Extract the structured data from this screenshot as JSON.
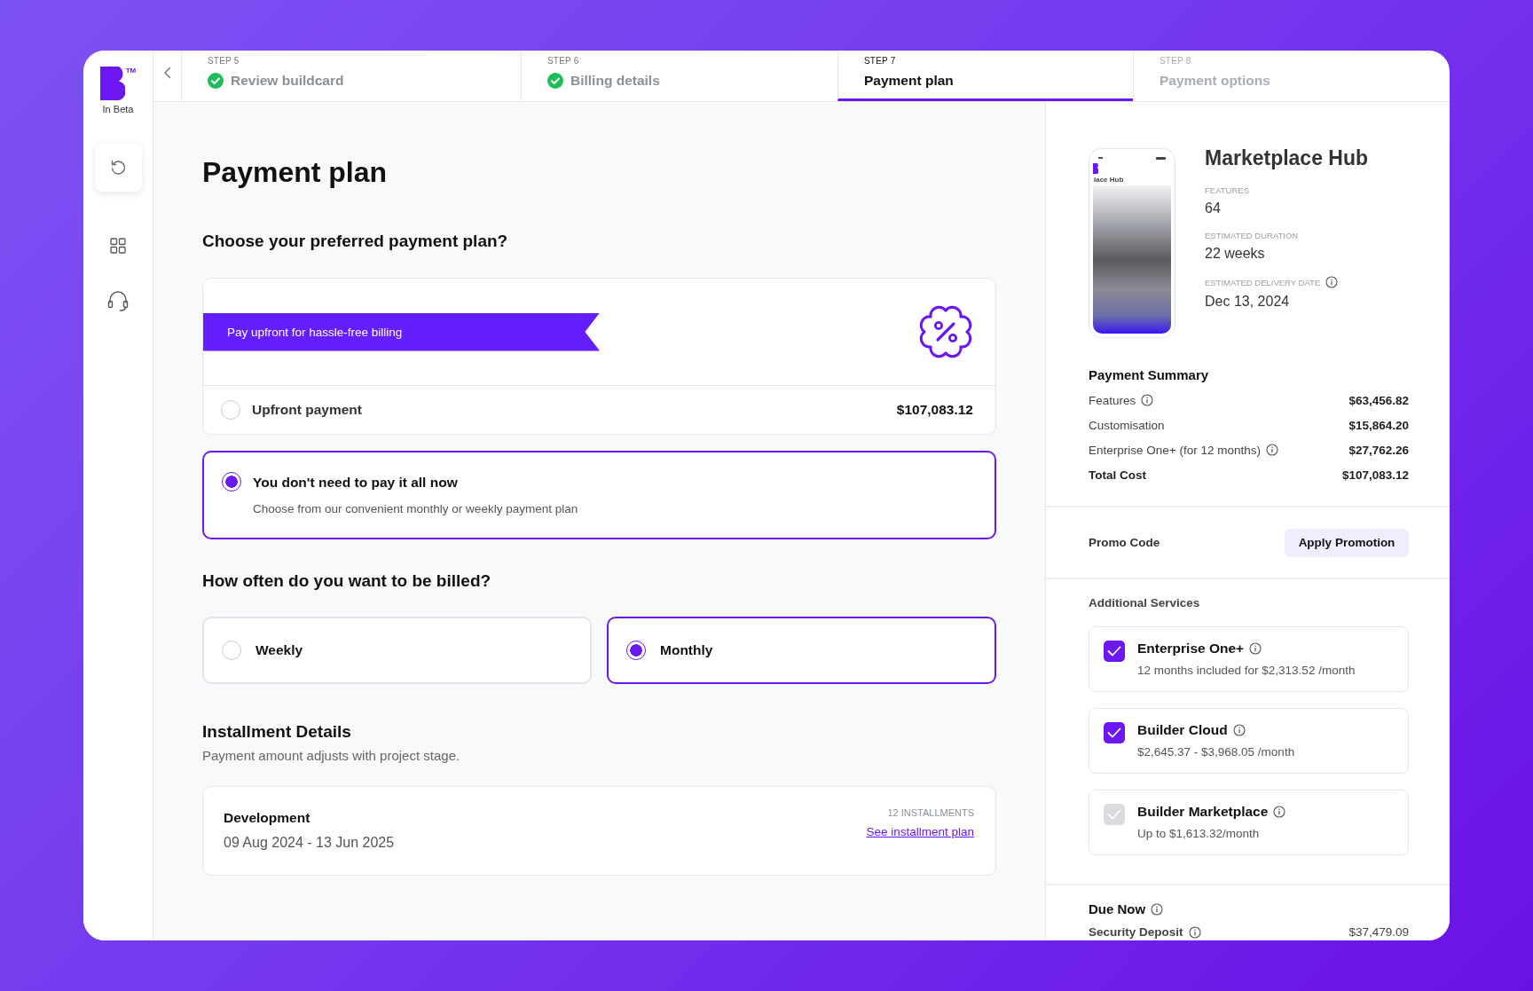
{
  "sidebar": {
    "logo_trademark": "TM",
    "logo_caption": "In Beta"
  },
  "stepper": {
    "steps": [
      {
        "label": "STEP 5",
        "title": "Review buildcard",
        "done": true,
        "selected": false
      },
      {
        "label": "STEP 6",
        "title": "Billing details",
        "done": true,
        "selected": false
      },
      {
        "label": "STEP 7",
        "title": "Payment plan",
        "done": false,
        "selected": true
      },
      {
        "label": "STEP 8",
        "title": "Payment options",
        "done": false,
        "selected": false
      }
    ]
  },
  "main": {
    "title": "Payment plan",
    "plan_question": "Choose your preferred payment plan?",
    "plans": [
      {
        "kind": "upfront",
        "banner": "Pay upfront for hassle-free billing",
        "label": "Upfront payment",
        "amount": "$107,083.12",
        "selected": false
      },
      {
        "kind": "installments",
        "label": "You don't need to pay it all now",
        "description": "Choose from our convenient monthly or weekly payment plan",
        "selected": true
      }
    ],
    "billing_question": "How often do you want to be billed?",
    "billing_options": [
      {
        "label": "Weekly",
        "selected": false
      },
      {
        "label": "Monthly",
        "selected": true
      }
    ],
    "installments": {
      "title": "Installment Details",
      "subtitle": "Payment amount adjusts with project stage.",
      "stages": [
        {
          "name": "Development",
          "dates": "09 Aug 2024 - 13 Jun 2025",
          "count": "12 INSTALLMENTS",
          "link": "See installment plan"
        }
      ]
    }
  },
  "summary": {
    "project": {
      "name": "Marketplace Hub",
      "preview_caption": "lace Hub",
      "stats": [
        {
          "label": "FEATURES",
          "value": "64",
          "info": false
        },
        {
          "label": "ESTIMATED DURATION",
          "value": "22 weeks",
          "info": false
        },
        {
          "label": "ESTIMATED DELIVERY DATE",
          "value": "Dec 13, 2024",
          "info": true
        }
      ]
    },
    "payment_summary": {
      "title": "Payment Summary",
      "rows": [
        {
          "kind": "item",
          "label": "Features",
          "amount": "$63,456.82",
          "info": true
        },
        {
          "kind": "item",
          "label": "Customisation",
          "amount": "$15,864.20",
          "info": false
        },
        {
          "kind": "item",
          "label": "Enterprise One+ (for 12 months)",
          "amount": "$27,762.26",
          "info": true
        },
        {
          "kind": "total",
          "label": "Total Cost",
          "amount": "$107,083.12",
          "info": false
        }
      ]
    },
    "promo": {
      "label": "Promo Code",
      "button": "Apply Promotion"
    },
    "additional_services": {
      "title": "Additional Services",
      "items": [
        {
          "name": "Enterprise One+",
          "price": "12 months included for $2,313.52 /month",
          "checked": true
        },
        {
          "name": "Builder Cloud",
          "price": "$2,645.37 - $3,968.05 /month",
          "checked": true
        },
        {
          "name": "Builder Marketplace",
          "price": "Up to $1,613.32/month",
          "checked": false
        }
      ]
    },
    "due_now": {
      "title": "Due Now",
      "rows": [
        {
          "label": "Security Deposit",
          "amount": "$37,479.09",
          "info": true
        }
      ]
    }
  }
}
